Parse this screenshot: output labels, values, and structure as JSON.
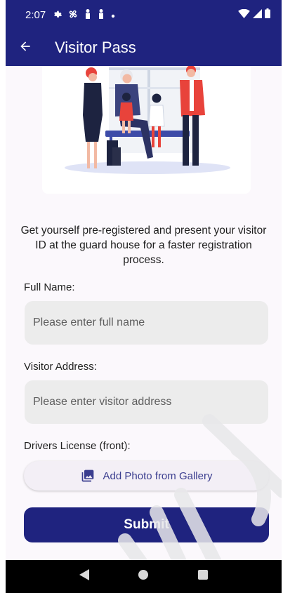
{
  "status_bar": {
    "time": "2:07",
    "icons": [
      "settings-icon",
      "fan-icon",
      "person-icon",
      "person-icon",
      "dot-icon"
    ],
    "right_icons": [
      "wifi-icon",
      "signal-icon",
      "battery-icon"
    ]
  },
  "app_bar": {
    "back_icon": "arrow-left-icon",
    "title": "Visitor Pass"
  },
  "hero": {
    "illustration": "family-visitors-illustration"
  },
  "intro_text": "Get yourself pre-registered and present your visitor ID at the guard house for a faster registration process.",
  "form": {
    "full_name": {
      "label": "Full Name:",
      "placeholder": "Please enter full name",
      "value": ""
    },
    "visitor_address": {
      "label": "Visitor Address:",
      "placeholder": "Please enter visitor address",
      "value": ""
    },
    "drivers_license": {
      "label": "Drivers License (front):",
      "button_label": "Add Photo from Gallery",
      "icon": "photo-library-icon"
    },
    "submit_label": "Submit"
  },
  "nav_bar": {
    "icons": [
      "back-triangle-icon",
      "home-circle-icon",
      "recents-square-icon"
    ]
  },
  "colors": {
    "primary": "#1f237f",
    "background": "#fbf8fc",
    "field": "#ececec",
    "button_text": "#3a3d8f"
  }
}
